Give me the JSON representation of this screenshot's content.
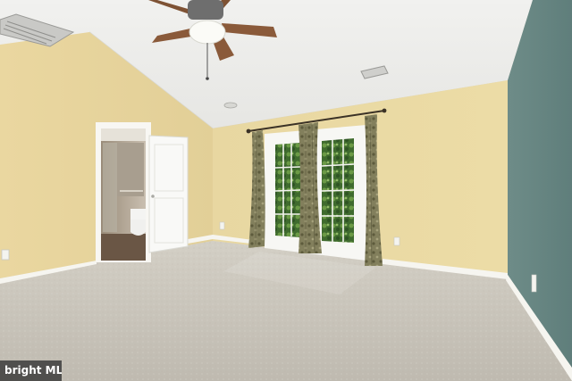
{
  "scene": {
    "description_tags": [
      "empty-bedroom",
      "vaulted-ceiling",
      "ceiling-fan",
      "french-doors",
      "carpet",
      "ensuite-bathroom"
    ],
    "colors": {
      "ceiling": "#eeeeec",
      "wall_yellow": "#e9d9a2",
      "wall_teal": "#6f8e8a",
      "carpet": "#cdc8bc",
      "trim": "#f7f6f1",
      "curtain": "#7d7a55",
      "window_green": "#4f7a3a"
    }
  },
  "watermark": {
    "text": "bright MLS"
  }
}
